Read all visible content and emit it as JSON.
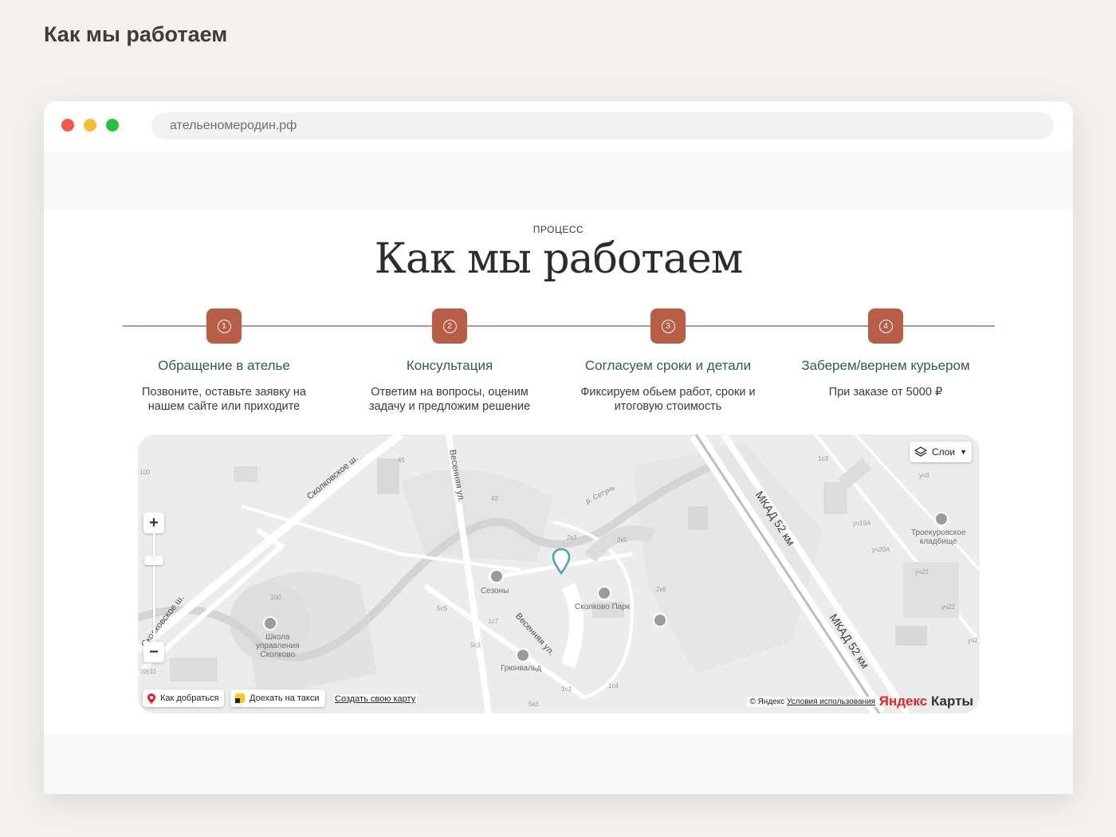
{
  "page_heading": "Как мы работаем",
  "browser": {
    "url": "ательеномеродин.рф"
  },
  "section": {
    "eyebrow": "ПРОЦЕСС",
    "title": "Как мы работаем"
  },
  "steps": [
    {
      "number": "1",
      "title": "Обращение в ателье",
      "desc_line1": "Позвоните, оставьте заявку на",
      "desc_line2": "нашем сайте или приходите"
    },
    {
      "number": "2",
      "title": "Консультация",
      "desc_line1": "Ответим на вопросы, оценим",
      "desc_line2": "задачу и предложим решение"
    },
    {
      "number": "3",
      "title": "Согласуем сроки и детали",
      "desc_line1": "Фиксируем обьем работ, сроки и",
      "desc_line2": "итоговую стоимость"
    },
    {
      "number": "4",
      "title": "Заберем/вернем курьером",
      "desc_line1": "При заказе от 5000 ₽",
      "desc_line2": ""
    }
  ],
  "colors": {
    "accent": "#b85e47",
    "step_title": "#2f5a5e",
    "timeline": "#c9907e"
  },
  "map": {
    "layers_label": "Слои",
    "zoom_in": "+",
    "zoom_out": "−",
    "route_chip": "Как добраться",
    "taxi_chip": "Доехать на такси",
    "create_map_link": "Создать свою карту",
    "copyright": "© Яндекс",
    "terms_link": "Условия использования",
    "logo_ya": "Яндекс",
    "logo_maps": " Карты",
    "labels": {
      "skolkovo_sh_top": "Сколковское ш.",
      "skolkovo_sh_left": "Сколковское ш.",
      "vesennyaya_top": "Весенняя ул.",
      "vesennyaya_bottom": "Весенняя ул.",
      "setun": "р. Сетунь",
      "mkad_top": "МКАД 52 км",
      "mkad_bottom": "МКАД 52 км",
      "sezony": "Сезоны",
      "skolkovo_park": "Сколково Парк",
      "grunwald": "Грюнвальд",
      "school_1": "Школа",
      "school_2": "управления",
      "school_3": "Сколково",
      "cemetery_1": "Троекуровское",
      "cemetery_2": "кладбище",
      "n100a": "100",
      "n100b": "100",
      "n45": "45",
      "n43": "43",
      "n2k3": "2к3",
      "n2k5": "2к5",
      "n2k6": "2к6",
      "n5s5": "5с5",
      "n1s7": "1с7",
      "n5s3": "5с3",
      "n1s3": "1с3",
      "n1s4": "1с4",
      "n5k3": "5к3",
      "n00s11": "00с11",
      "n1s3b": "1с3",
      "u3": "уч3",
      "u19a": "уч19А",
      "u20a": "уч20А",
      "u21": "уч21",
      "u22": "уч22",
      "u2": "уч2"
    }
  }
}
